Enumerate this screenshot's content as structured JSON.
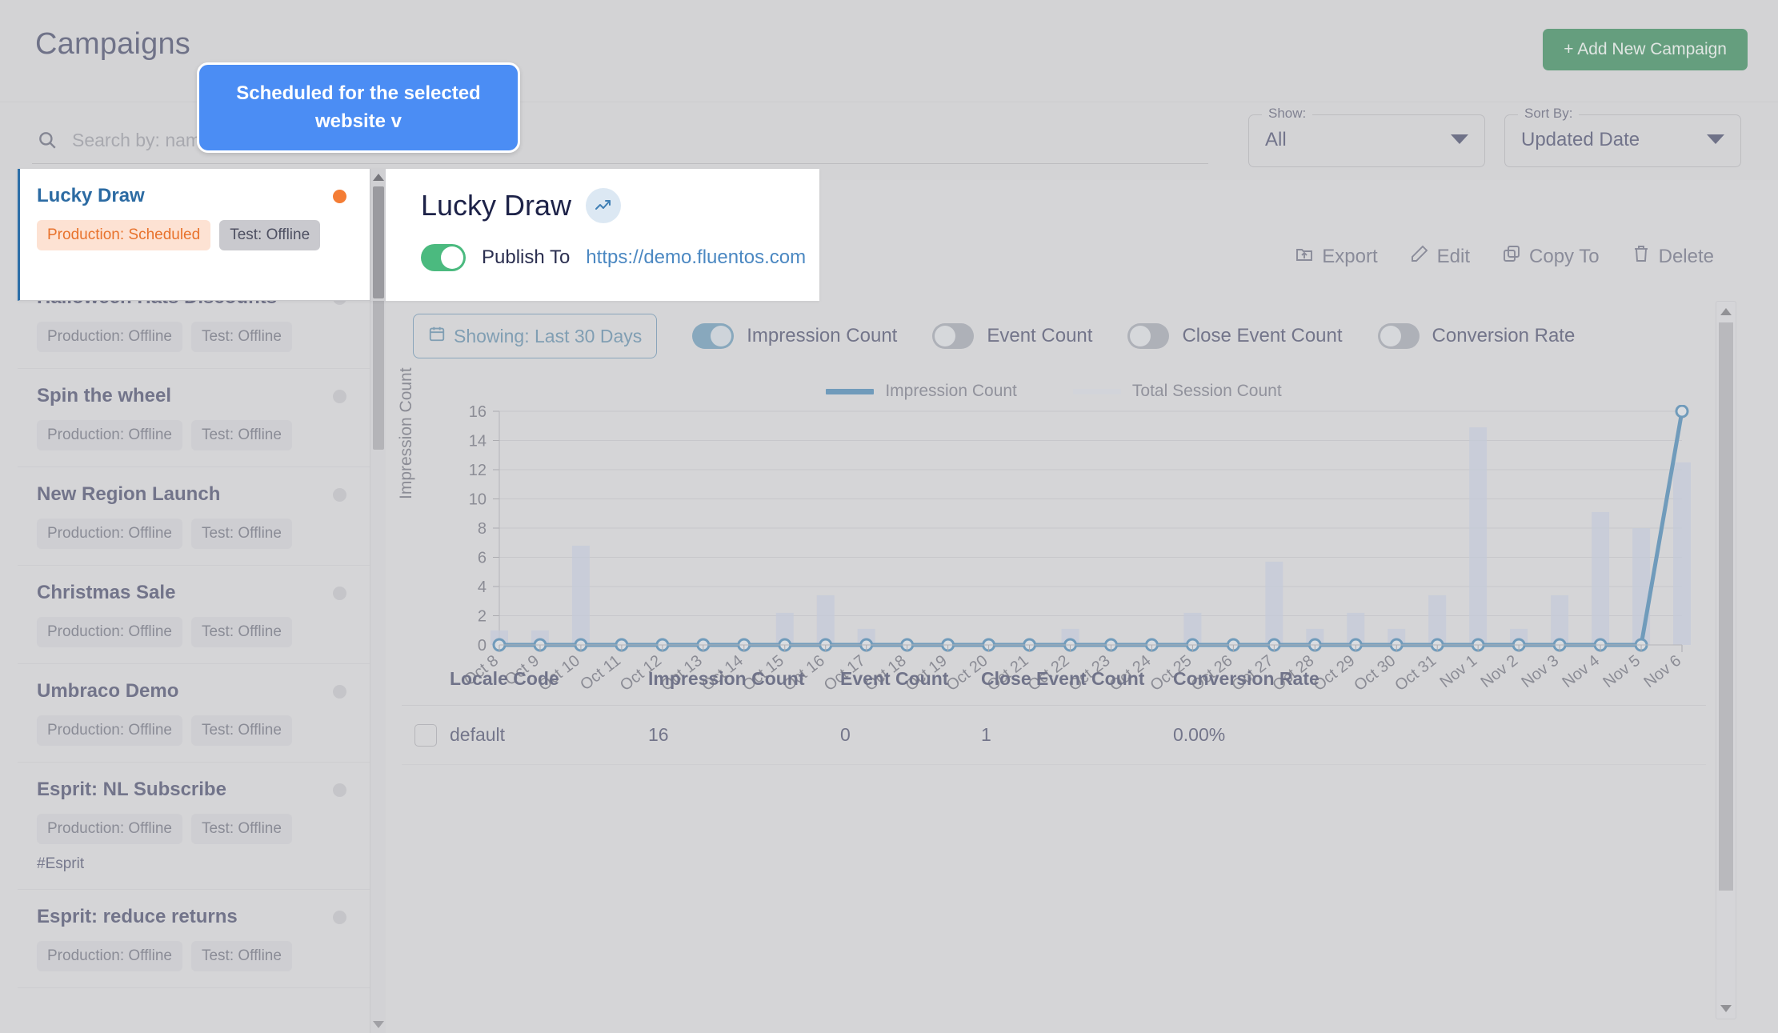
{
  "header": {
    "title": "Campaigns",
    "add_button": "+ Add New Campaign"
  },
  "search": {
    "placeholder": "Search by: name",
    "value": "",
    "icon": "search-icon"
  },
  "filters": {
    "show": {
      "legend": "Show:",
      "value": "All"
    },
    "sort": {
      "legend": "Sort By:",
      "value": "Updated Date"
    }
  },
  "tooltip": {
    "text": "Scheduled for the selected website v"
  },
  "campaign_list": [
    {
      "name": "Lucky Draw",
      "production": "Production: Scheduled",
      "test": "Test: Offline",
      "status": "scheduled",
      "tag": "",
      "active": true
    },
    {
      "name": "Halloween Hats Discounts",
      "production": "Production: Offline",
      "test": "Test: Offline",
      "status": "offline",
      "tag": "",
      "active": false
    },
    {
      "name": "Spin the wheel",
      "production": "Production: Offline",
      "test": "Test: Offline",
      "status": "offline",
      "tag": "",
      "active": false
    },
    {
      "name": "New Region Launch",
      "production": "Production: Offline",
      "test": "Test: Offline",
      "status": "offline",
      "tag": "",
      "active": false
    },
    {
      "name": "Christmas Sale",
      "production": "Production: Offline",
      "test": "Test: Offline",
      "status": "offline",
      "tag": "",
      "active": false
    },
    {
      "name": "Umbraco Demo",
      "production": "Production: Offline",
      "test": "Test: Offline",
      "status": "offline",
      "tag": "",
      "active": false
    },
    {
      "name": "Esprit: NL Subscribe",
      "production": "Production: Offline",
      "test": "Test: Offline",
      "status": "offline",
      "tag": "#Esprit",
      "active": false
    },
    {
      "name": "Esprit: reduce returns",
      "production": "Production: Offline",
      "test": "Test: Offline",
      "status": "offline",
      "tag": "",
      "active": false
    }
  ],
  "detail": {
    "title": "Lucky Draw",
    "trend_icon": "trending-up-icon",
    "publish_enabled": true,
    "publish_label": "Publish To",
    "publish_url": "https://demo.fluentos.com"
  },
  "actions": [
    {
      "label": "Export",
      "icon": "export-icon"
    },
    {
      "label": "Edit",
      "icon": "pencil-icon"
    },
    {
      "label": "Copy To",
      "icon": "copy-icon"
    },
    {
      "label": "Delete",
      "icon": "trash-icon"
    }
  ],
  "chart_toolbar": {
    "date_button": "Showing: Last 30 Days",
    "date_icon": "calendar-icon",
    "metric_toggles": [
      {
        "label": "Impression Count",
        "on": true
      },
      {
        "label": "Event Count",
        "on": false
      },
      {
        "label": "Close Event Count",
        "on": false
      },
      {
        "label": "Conversion Rate",
        "on": false
      }
    ]
  },
  "chart_data": {
    "type": "line",
    "title": "",
    "xlabel": "",
    "ylabel": "Impression Count",
    "ylim": [
      0,
      16
    ],
    "yticks": [
      0,
      2,
      4,
      6,
      8,
      10,
      12,
      14,
      16
    ],
    "grid": true,
    "legend_position": "top-center",
    "legend": [
      "Impression Count",
      "Total Session Count"
    ],
    "colors": {
      "impression_line": "#1e6ca4",
      "session_bar": "#b9c4db"
    },
    "categories": [
      "Oct 8",
      "Oct 9",
      "Oct 10",
      "Oct 11",
      "Oct 12",
      "Oct 13",
      "Oct 14",
      "Oct 15",
      "Oct 16",
      "Oct 17",
      "Oct 18",
      "Oct 19",
      "Oct 20",
      "Oct 21",
      "Oct 22",
      "Oct 23",
      "Oct 24",
      "Oct 25",
      "Oct 26",
      "Oct 27",
      "Oct 28",
      "Oct 29",
      "Oct 30",
      "Oct 31",
      "Nov 1",
      "Nov 2",
      "Nov 3",
      "Nov 4",
      "Nov 5",
      "Nov 6"
    ],
    "series": [
      {
        "name": "Impression Count",
        "type": "line",
        "values": [
          0,
          0,
          0,
          0,
          0,
          0,
          0,
          0,
          0,
          0,
          0,
          0,
          0,
          0,
          0,
          0,
          0,
          0,
          0,
          0,
          0,
          0,
          0,
          0,
          0,
          0,
          0,
          0,
          0,
          16
        ]
      },
      {
        "name": "Total Session Count",
        "type": "bar",
        "values": [
          1,
          1,
          6.8,
          0,
          0,
          0,
          0,
          2.2,
          3.4,
          1.1,
          0,
          0,
          0,
          0,
          1.1,
          0,
          0,
          2.2,
          0,
          5.7,
          1.1,
          2.2,
          1.1,
          3.4,
          14.9,
          1.1,
          3.4,
          9.1,
          8,
          12.5
        ]
      }
    ]
  },
  "table": {
    "columns": [
      "Locale Code",
      "Impression Count",
      "Event Count",
      "Close Event Count",
      "Conversion Rate"
    ],
    "rows": [
      {
        "locale": "default",
        "impressions": "16",
        "events": "0",
        "close_events": "1",
        "conversion": "0.00%"
      }
    ]
  }
}
